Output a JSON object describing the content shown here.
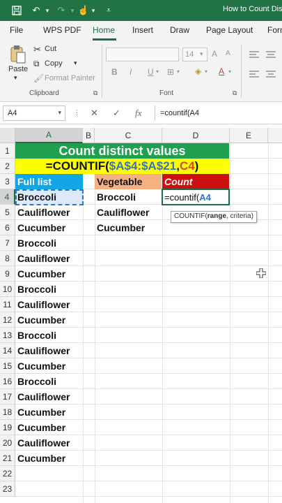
{
  "window": {
    "title": "How to Count Dist"
  },
  "ribbon_tabs": [
    "File",
    "WPS PDF",
    "Home",
    "Insert",
    "Draw",
    "Page Layout",
    "Form"
  ],
  "active_tab": "Home",
  "clipboard": {
    "paste_label": "Paste",
    "cut_label": "Cut",
    "copy_label": "Copy",
    "format_painter_label": "Format Painter",
    "group_label": "Clipboard"
  },
  "font_group": {
    "size_value": "14",
    "bold": "B",
    "italic": "I",
    "underline": "U",
    "grow": "A",
    "shrink": "A",
    "group_label": "Font"
  },
  "formula_bar": {
    "name_box": "A4",
    "cancel": "✕",
    "enter": "✓",
    "fx": "fx",
    "content": "=countif(A4"
  },
  "columns": [
    "A",
    "B",
    "C",
    "D",
    "E"
  ],
  "rows": [
    "1",
    "2",
    "3",
    "4",
    "5",
    "6",
    "7",
    "8",
    "9",
    "10",
    "11",
    "12",
    "13",
    "14",
    "15",
    "16",
    "17",
    "18",
    "19",
    "20",
    "21",
    "22",
    "23"
  ],
  "sheet": {
    "title": "Count distinct values",
    "formula_parts": [
      {
        "text": "=COUNTIF(",
        "color": "black"
      },
      {
        "text": "$A$4:$A$21",
        "color": "blue"
      },
      {
        "text": ",",
        "color": "black"
      },
      {
        "text": "C4",
        "color": "red"
      },
      {
        "text": ")",
        "color": "black"
      }
    ],
    "header_full_list": "Full list",
    "header_vegetable": "Vegetable",
    "header_count": "Count",
    "full_list": [
      "Broccoli",
      "Cauliflower",
      "Cucumber",
      "Broccoli",
      "Cauliflower",
      "Cucumber",
      "Broccoli",
      "Cauliflower",
      "Cucumber",
      "Broccoli",
      "Cauliflower",
      "Cucumber",
      "Broccoli",
      "Cauliflower",
      "Cucumber",
      "Cucumber",
      "Cauliflower",
      "Cucumber"
    ],
    "vegetables": [
      "Broccoli",
      "Cauliflower",
      "Cucumber"
    ],
    "edit_cell": {
      "prefix": "=countif(",
      "ref": "A4"
    },
    "tooltip": {
      "fn": "COUNTIF(",
      "arg1": "range",
      "sep": ", criteria)"
    }
  },
  "colors": {
    "excel_green": "#217346",
    "title_green": "#1fa04f",
    "formula_yellow": "#ffff00",
    "header_blue": "#12a6e6",
    "header_orange": "#f6b183",
    "header_red": "#cc1010",
    "ref_blue": "#2f74c9",
    "ref_red": "#e23f2e"
  }
}
